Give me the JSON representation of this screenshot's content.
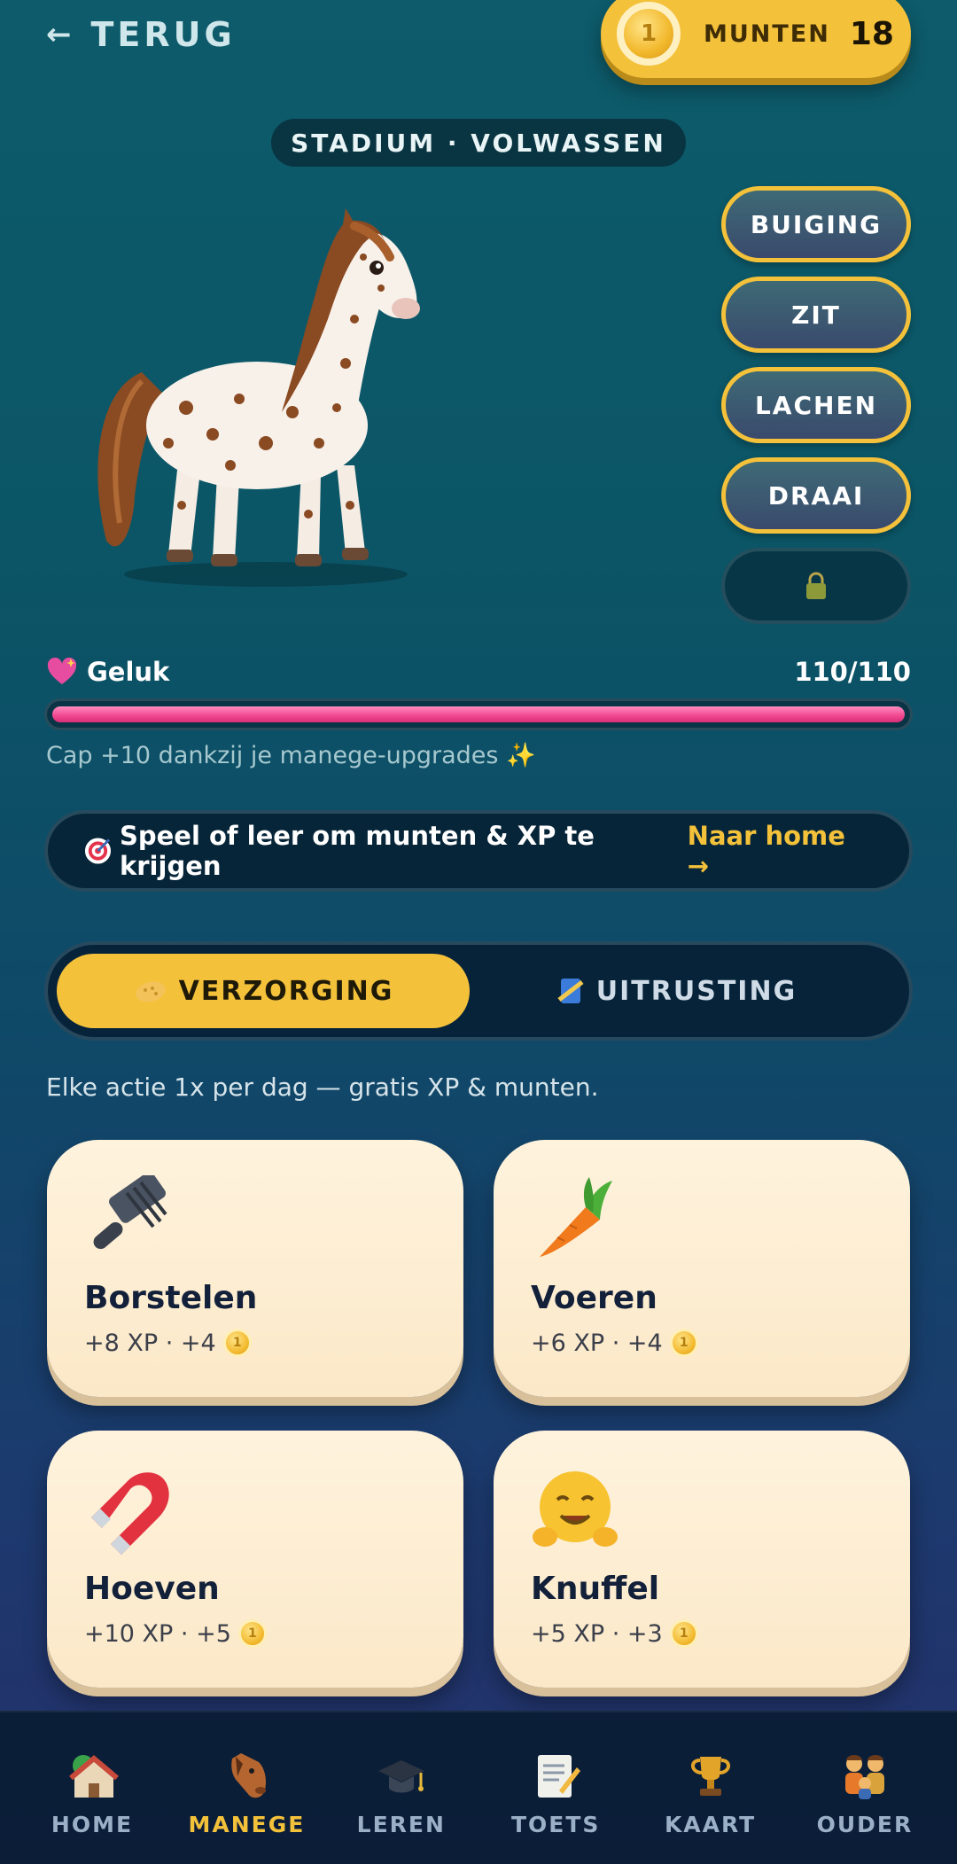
{
  "header": {
    "back_arrow": "←",
    "back_label": "TERUG",
    "coins_label": "MUNTEN",
    "coins_count": "18"
  },
  "pet": {
    "stage": "STADIUM · VOLWASSEN",
    "icon": "spotted-horse-illustration"
  },
  "tricks": [
    {
      "label": "BUIGING"
    },
    {
      "label": "ZIT"
    },
    {
      "label": "LACHEN"
    },
    {
      "label": "DRAAI"
    },
    {
      "label": "",
      "icon": "lock-icon"
    }
  ],
  "happiness": {
    "label": "Geluk",
    "value": "110/110",
    "fill": 1.0,
    "icon": "sparkling-heart-icon",
    "color": "#f0468f"
  },
  "cap_note": "Cap +10 dankzij je manege-upgrades ✨",
  "cta": {
    "text": "Speel of leer om munten & XP te krijgen",
    "link": "Naar home →",
    "icon": "target-icon"
  },
  "tabs": [
    {
      "label": "VERZORGING",
      "icon": "sponge-icon",
      "active": true
    },
    {
      "label": "UITRUSTING",
      "icon": "rope-icon",
      "active": false
    }
  ],
  "hint": "Elke actie 1x per dag — gratis XP & munten.",
  "care_actions": [
    {
      "title": "Borstelen",
      "reward": "+8 XP · +4",
      "icon": "brush-icon"
    },
    {
      "title": "Voeren",
      "reward": "+6 XP · +4",
      "icon": "carrot-icon"
    },
    {
      "title": "Hoeven",
      "reward": "+10 XP · +5",
      "icon": "magnet-icon"
    },
    {
      "title": "Knuffel",
      "reward": "+5 XP · +3",
      "icon": "hugging-face-icon"
    }
  ],
  "nav": [
    {
      "label": "HOME",
      "icon": "house-icon",
      "active": false
    },
    {
      "label": "MANEGE",
      "icon": "horse-face-icon",
      "active": true
    },
    {
      "label": "LEREN",
      "icon": "graduation-cap-icon",
      "active": false
    },
    {
      "label": "TOETS",
      "icon": "memo-icon",
      "active": false
    },
    {
      "label": "KAART",
      "icon": "trophy-icon",
      "active": false
    },
    {
      "label": "OUDER",
      "icon": "family-icon",
      "active": false
    }
  ],
  "colors": {
    "accent": "#f4c13a",
    "happiness_bar": "#f0468f",
    "card_bg": "#fff3dd"
  }
}
